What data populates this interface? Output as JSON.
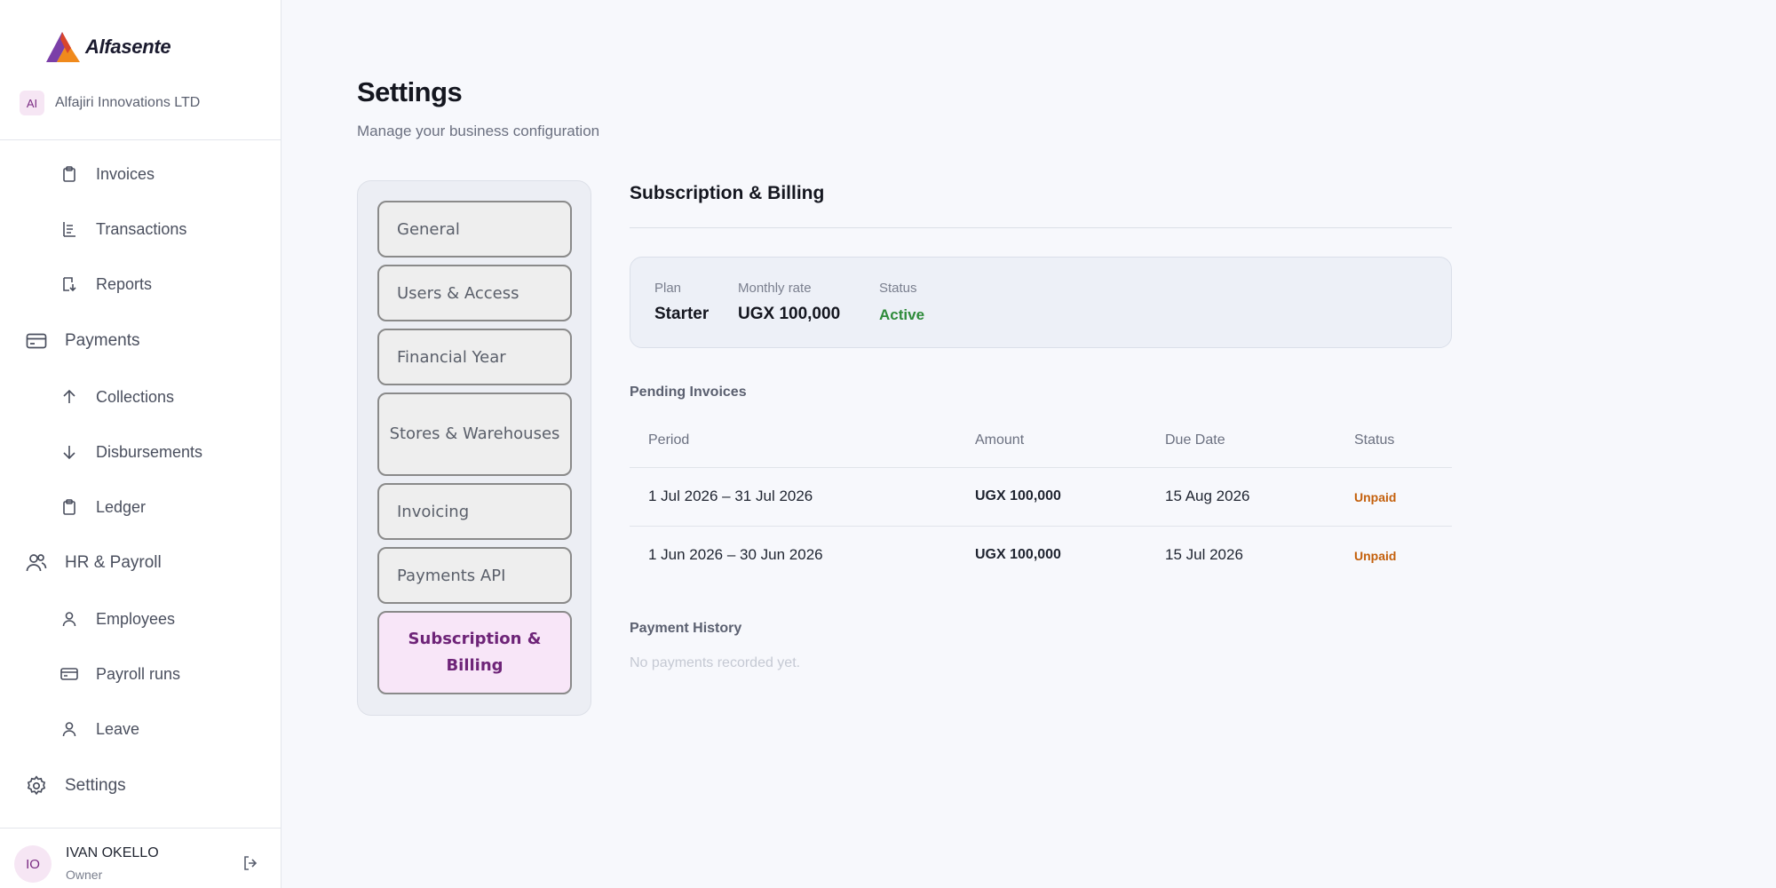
{
  "brand": {
    "name": "Alfasente"
  },
  "org": {
    "initials": "AI",
    "name": "Alfajiri Innovations LTD"
  },
  "nav": {
    "invoices": "Invoices",
    "transactions": "Transactions",
    "reports": "Reports",
    "payments": "Payments",
    "collections": "Collections",
    "disbursements": "Disbursements",
    "ledger": "Ledger",
    "hr_payroll": "HR & Payroll",
    "employees": "Employees",
    "payroll_runs": "Payroll runs",
    "leave": "Leave",
    "settings": "Settings"
  },
  "user": {
    "initials": "IO",
    "name": "IVAN OKELLO",
    "role": "Owner"
  },
  "page": {
    "title": "Settings",
    "subtitle": "Manage your business configuration"
  },
  "tabs": [
    {
      "label": "General"
    },
    {
      "label": "Users & Access"
    },
    {
      "label": "Financial Year"
    },
    {
      "label": "Stores & Warehouses"
    },
    {
      "label": "Invoicing"
    },
    {
      "label": "Payments API"
    },
    {
      "label": "Subscription & Billing"
    }
  ],
  "billing": {
    "title": "Subscription & Billing",
    "plan_label": "Plan",
    "plan_value": "Starter",
    "rate_label": "Monthly rate",
    "rate_value": "UGX 100,000",
    "status_label": "Status",
    "status_value": "Active",
    "pending_title": "Pending Invoices",
    "columns": {
      "period": "Period",
      "amount": "Amount",
      "due": "Due Date",
      "status": "Status"
    },
    "invoices": [
      {
        "period": "1 Jul 2026 – 31 Jul 2026",
        "amount": "UGX 100,000",
        "due": "15 Aug 2026",
        "status": "Unpaid"
      },
      {
        "period": "1 Jun 2026 – 30 Jun 2026",
        "amount": "UGX 100,000",
        "due": "15 Jul 2026",
        "status": "Unpaid"
      }
    ],
    "history_title": "Payment History",
    "history_empty": "No payments recorded yet."
  },
  "colors": {
    "accent": "#6e2478",
    "active_status": "#2e8b3a",
    "unpaid": "#c4600c"
  }
}
